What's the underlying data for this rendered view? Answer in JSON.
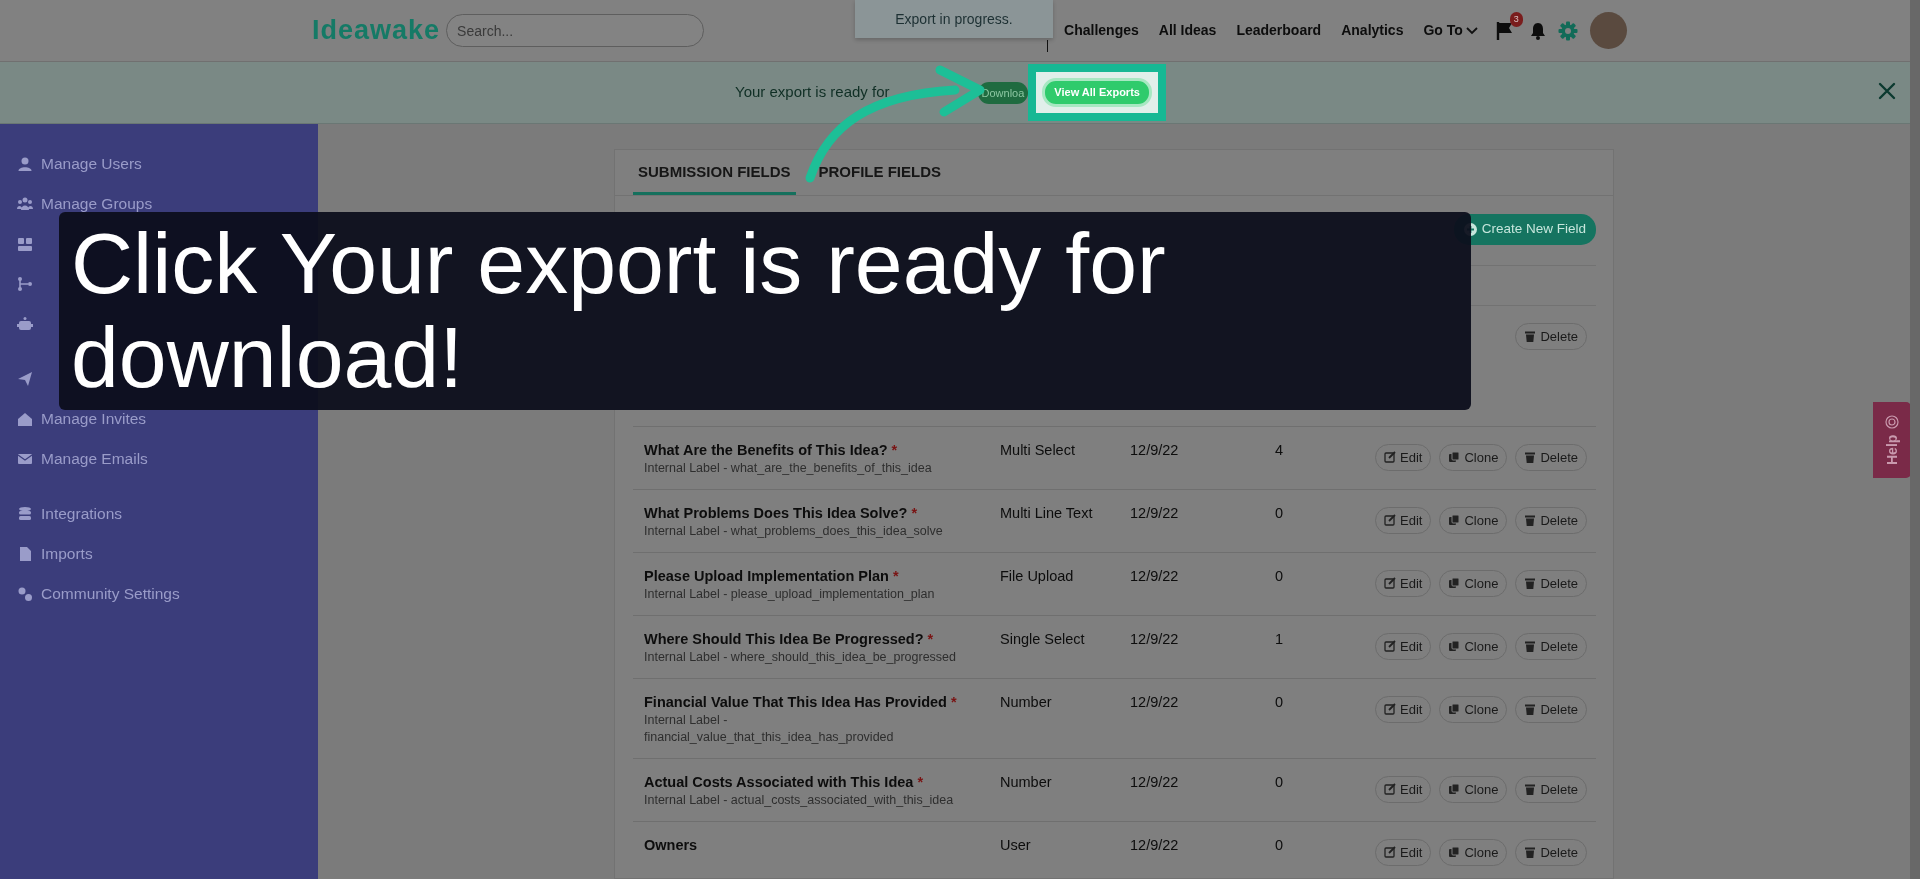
{
  "top_bar": {
    "logo": "Ideawake",
    "search": {
      "placeholder": "Search..."
    },
    "nav": [
      {
        "label": "Challenges",
        "kind": "link"
      },
      {
        "label": "All Ideas",
        "kind": "link"
      },
      {
        "label": "Leaderboard",
        "kind": "link"
      },
      {
        "label": "Analytics",
        "kind": "link"
      },
      {
        "label": "Go To",
        "kind": "dropdown"
      }
    ],
    "flag_badge": "3"
  },
  "toast": {
    "text": "Export in progress."
  },
  "banner": {
    "text": "Your export is ready for",
    "download_button": "Downloa",
    "view_all_button": "View All Exports"
  },
  "sidebar": {
    "groups": [
      [
        {
          "kind": "labeled",
          "label": "Manage Users"
        },
        {
          "kind": "labeled",
          "label": "Manage Groups"
        },
        {
          "kind": "icon_only"
        },
        {
          "kind": "icon_only"
        },
        {
          "kind": "icon_only"
        }
      ],
      [
        {
          "kind": "icon_only"
        },
        {
          "kind": "labeled",
          "label": "Manage Invites"
        },
        {
          "kind": "labeled",
          "label": "Manage Emails"
        }
      ],
      [
        {
          "kind": "labeled",
          "label": "Integrations"
        },
        {
          "kind": "labeled",
          "label": "Imports"
        },
        {
          "kind": "labeled",
          "label": "Community Settings"
        }
      ]
    ]
  },
  "tabs": [
    {
      "label": "SUBMISSION FIELDS",
      "selected": true
    },
    {
      "label": "PROFILE FIELDS",
      "selected": false
    }
  ],
  "toolbar": {
    "create_button": "Create New Field"
  },
  "table": {
    "required_mark": "*",
    "rows": [
      {
        "actions": [
          "Delete"
        ]
      },
      {
        "label": "What Are the Benefits of This Idea?",
        "required": true,
        "internal_label": "Internal Label - what_are_the_benefits_of_this_idea",
        "type": "Multi Select",
        "created": "12/9/22",
        "entries": "4",
        "actions": [
          "Edit",
          "Clone",
          "Delete"
        ]
      },
      {
        "label": "What Problems Does This Idea Solve?",
        "required": true,
        "internal_label": "Internal Label - what_problems_does_this_idea_solve",
        "type": "Multi Line Text",
        "created": "12/9/22",
        "entries": "0",
        "actions": [
          "Edit",
          "Clone",
          "Delete"
        ]
      },
      {
        "label": "Please Upload Implementation Plan",
        "required": true,
        "internal_label": "Internal Label - please_upload_implementation_plan",
        "type": "File Upload",
        "created": "12/9/22",
        "entries": "0",
        "actions": [
          "Edit",
          "Clone",
          "Delete"
        ]
      },
      {
        "label": "Where Should This Idea Be Progressed?",
        "required": true,
        "internal_label": "Internal Label - where_should_this_idea_be_progressed",
        "type": "Single Select",
        "created": "12/9/22",
        "entries": "1",
        "actions": [
          "Edit",
          "Clone",
          "Delete"
        ]
      },
      {
        "label": "Financial Value That This Idea Has Provided",
        "required": true,
        "internal_label": "Internal Label - financial_value_that_this_idea_has_provided",
        "type": "Number",
        "created": "12/9/22",
        "entries": "0",
        "actions": [
          "Edit",
          "Clone",
          "Delete"
        ]
      },
      {
        "label": "Actual Costs Associated with This Idea",
        "required": true,
        "internal_label": "Internal Label - actual_costs_associated_with_this_idea",
        "type": "Number",
        "created": "12/9/22",
        "entries": "0",
        "actions": [
          "Edit",
          "Clone",
          "Delete"
        ]
      },
      {
        "label": "Owners",
        "required": false,
        "type": "User",
        "created": "12/9/22",
        "entries": "0",
        "actions": [
          "Edit",
          "Clone",
          "Delete"
        ]
      }
    ]
  },
  "help_tab": {
    "label": "Help"
  },
  "tutorial": {
    "caption": "Click Your export is ready for download!"
  }
}
